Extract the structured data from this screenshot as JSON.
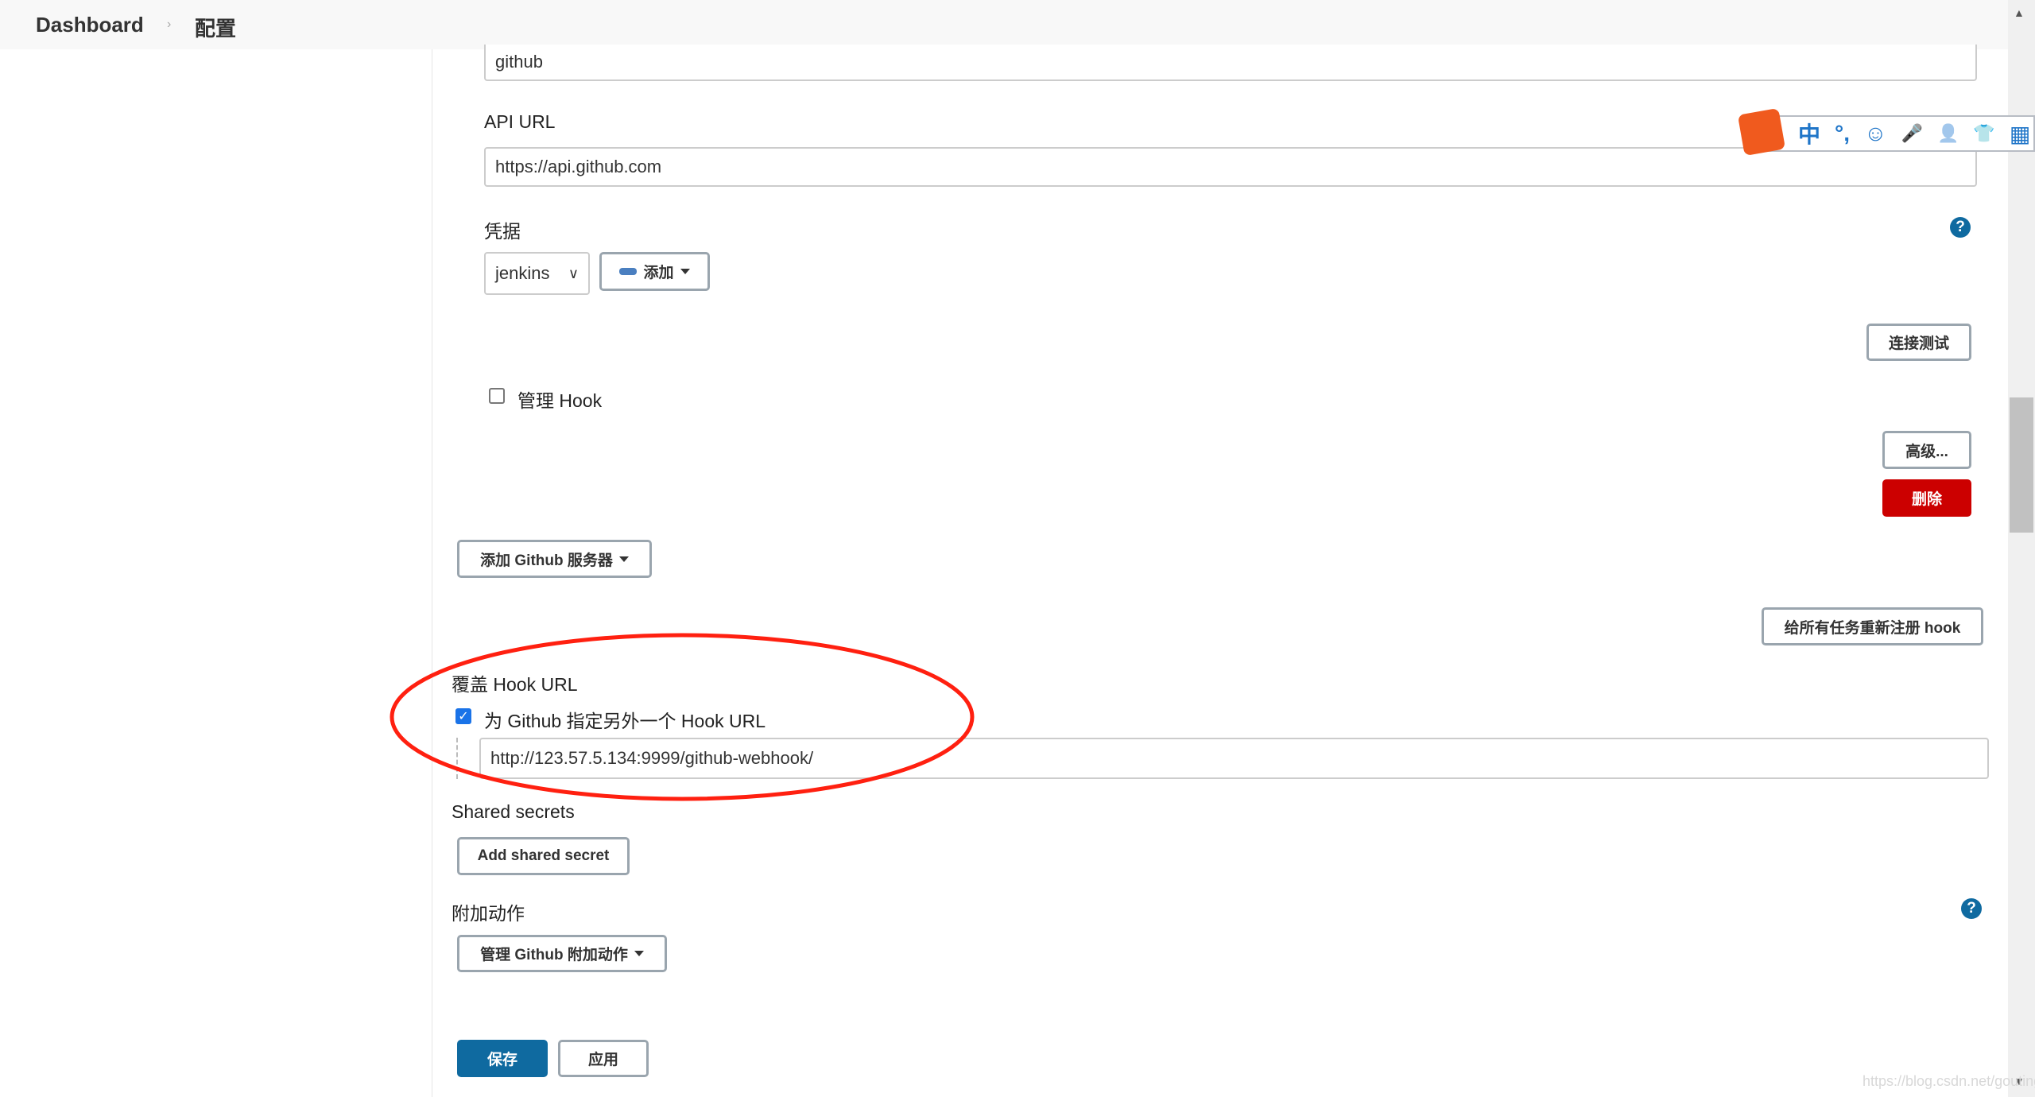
{
  "breadcrumb": {
    "items": [
      "Dashboard",
      "配置"
    ]
  },
  "form": {
    "name_value": "github",
    "api_url_label": "API URL",
    "api_url_value": "https://api.github.com",
    "credentials_label": "凭据",
    "credentials_selected": "jenkins",
    "add_button": "添加",
    "test_connection_button": "连接测试",
    "manage_hook_label": "管理 Hook",
    "manage_hook_checked": false,
    "advanced_button": "高级...",
    "delete_button": "删除",
    "add_server_button": "添加 Github 服务器",
    "reregister_button": "给所有任务重新注册 hook",
    "override_label": "覆盖 Hook URL",
    "override_checkbox_label": "为 Github 指定另外一个 Hook URL",
    "override_checked": true,
    "hook_url_value": "http://123.57.5.134:9999/github-webhook/",
    "shared_secrets_label": "Shared secrets",
    "add_secret_button": "Add shared secret",
    "additional_actions_label": "附加动作",
    "manage_actions_button": "管理 Github 附加动作",
    "help": "?"
  },
  "footer": {
    "save_button": "保存",
    "apply_button": "应用"
  },
  "ime": {
    "items": [
      "中",
      "°,",
      "☺",
      "🎤",
      "👤",
      "👕",
      "▦"
    ],
    "logo": "S"
  },
  "watermark": "https://blog.csdn.net/goutingd",
  "colors": {
    "primary": "#0f6aa0",
    "danger": "#cc0000",
    "annotation": "#ff2010"
  }
}
